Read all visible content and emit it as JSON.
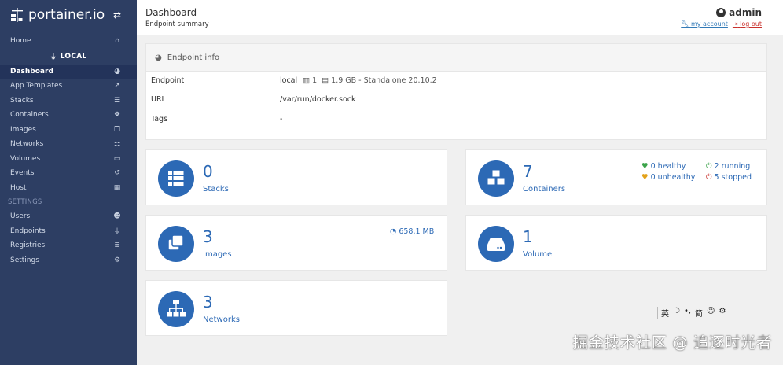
{
  "brand": {
    "text": "portainer.io",
    "toggle_icon": "exchange-icon"
  },
  "sidebar": {
    "home": "Home",
    "endpoint_name": "LOCAL",
    "items": [
      {
        "label": "Dashboard",
        "icon": "tachometer-icon",
        "active": true
      },
      {
        "label": "App Templates",
        "icon": "rocket-icon"
      },
      {
        "label": "Stacks",
        "icon": "th-list-icon"
      },
      {
        "label": "Containers",
        "icon": "cubes-icon"
      },
      {
        "label": "Images",
        "icon": "clone-icon"
      },
      {
        "label": "Networks",
        "icon": "sitemap-icon"
      },
      {
        "label": "Volumes",
        "icon": "hdd-icon"
      },
      {
        "label": "Events",
        "icon": "history-icon"
      },
      {
        "label": "Host",
        "icon": "th-icon"
      }
    ],
    "settings_heading": "SETTINGS",
    "settings_items": [
      {
        "label": "Users",
        "icon": "users-icon"
      },
      {
        "label": "Endpoints",
        "icon": "plug-icon"
      },
      {
        "label": "Registries",
        "icon": "database-icon"
      },
      {
        "label": "Settings",
        "icon": "cogs-icon"
      }
    ]
  },
  "header": {
    "title": "Dashboard",
    "subtitle": "Endpoint summary",
    "user": "admin",
    "my_account": "my account",
    "log_out": "log out"
  },
  "endpoint_info": {
    "heading": "Endpoint info",
    "rows": [
      {
        "key": "Endpoint",
        "name": "local",
        "cpu": "1",
        "memory": "1.9 GB - Standalone 20.10.2"
      },
      {
        "key": "URL",
        "value": "/var/run/docker.sock"
      },
      {
        "key": "Tags",
        "value": "-"
      }
    ]
  },
  "widgets": {
    "stacks": {
      "count": "0",
      "label": "Stacks"
    },
    "containers": {
      "count": "7",
      "label": "Containers",
      "healthy": "0 healthy",
      "unhealthy": "0 unhealthy",
      "running": "2 running",
      "stopped": "5 stopped"
    },
    "images": {
      "count": "3",
      "label": "Images",
      "size": "658.1 MB"
    },
    "volumes": {
      "count": "1",
      "label": "Volume"
    },
    "networks": {
      "count": "3",
      "label": "Networks"
    }
  },
  "overlay": {
    "toolbar": [
      "英",
      "☽",
      "•,",
      "简",
      "☺",
      "⚙"
    ],
    "watermark": "掘金技术社区 @ 追逐时光者"
  },
  "colors": {
    "sidebar": "#2d3e63",
    "sidebar_active": "#23335a",
    "accent": "#2c69b5",
    "healthy": "#3ca34a",
    "unhealthy": "#e3a21a",
    "stopped": "#c9302c"
  }
}
